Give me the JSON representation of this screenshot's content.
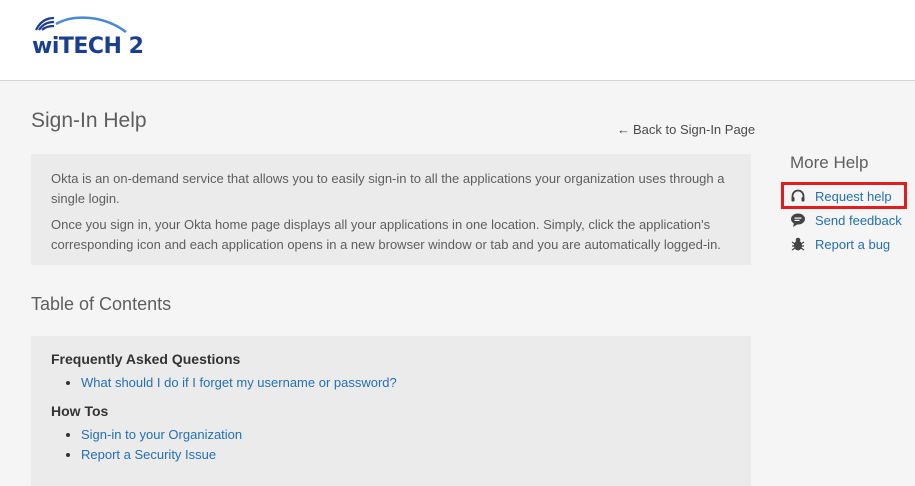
{
  "brand": {
    "logo_text": "wiTECH 2",
    "color": "#1b3f8f"
  },
  "page": {
    "title": "Sign-In Help",
    "back_link": "Back to Sign-In Page",
    "back_arrow": "←"
  },
  "intro": {
    "paragraphs": [
      "Okta is an on-demand service that allows you to easily sign-in to all the applications your organization uses through a single login.",
      "Once you sign in, your Okta home page displays all your applications in one location. Simply, click the application's corresponding icon and each application opens in a new browser window or tab and you are automatically logged-in."
    ]
  },
  "toc": {
    "title": "Table of Contents",
    "sections": [
      {
        "heading": "Frequently Asked Questions",
        "links": [
          "What should I do if I forget my username or password?"
        ]
      },
      {
        "heading": "How Tos",
        "links": [
          "Sign-in to your Organization",
          "Report a Security Issue"
        ]
      }
    ]
  },
  "more_help": {
    "title": "More Help",
    "links": [
      {
        "label": "Request help",
        "icon": "headset-icon"
      },
      {
        "label": "Send feedback",
        "icon": "chat-bubble-icon"
      },
      {
        "label": "Report a bug",
        "icon": "bug-icon"
      }
    ],
    "highlight_color": "#e01e1e"
  },
  "colors": {
    "link": "#2470b3",
    "box_bg": "#ebebeb",
    "page_bg": "#f5f5f5"
  }
}
